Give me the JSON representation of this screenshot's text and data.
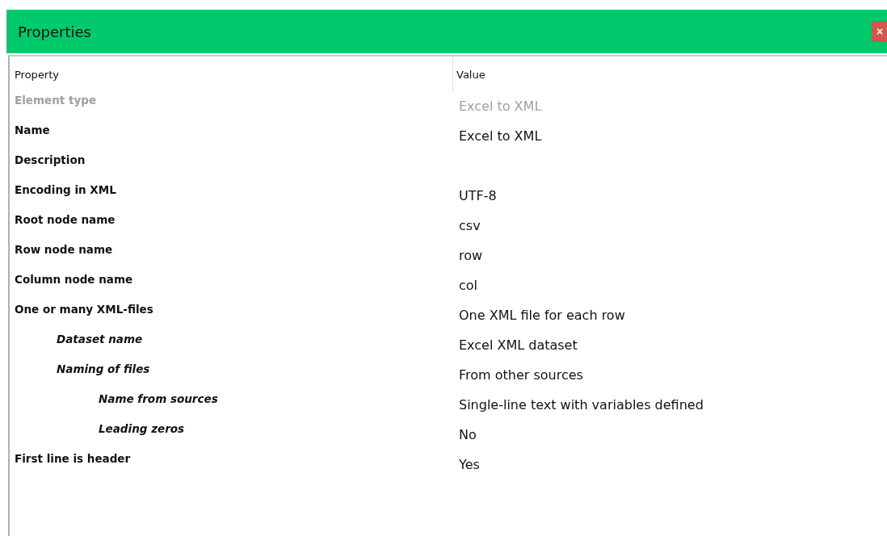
{
  "window": {
    "title": "Properties",
    "close": "×"
  },
  "table": {
    "columns": [
      "Property",
      "Value"
    ],
    "rows": [
      {
        "property": "Element type",
        "value": "Excel to XML",
        "disabled": true
      },
      {
        "property": "Name",
        "value": "Excel to XML",
        "disabled": false
      },
      {
        "property": "Description",
        "disabled": false
      },
      {
        "property": "Encoding in XML",
        "value": "UTF-8",
        "disabled": false
      },
      {
        "property": "Root node name",
        "value": "csv",
        "disabled": false
      },
      {
        "property": "Row node name",
        "value": "row",
        "disabled": false
      },
      {
        "property": "Column node name",
        "value": "col",
        "disabled": false
      },
      {
        "property": "One or many XML-files",
        "value": "One XML file for each row",
        "disabled": false,
        "children": [
          {
            "property": "Dataset name",
            "value": "Excel XML dataset",
            "disabled": false
          },
          {
            "property": "Naming of files",
            "value": "From other sources",
            "disabled": false,
            "children": [
              {
                "property": "Name from sources",
                "value": "Single-line text with variables defined",
                "disabled": false
              },
              {
                "property": "Leading zeros",
                "value": "No",
                "disabled": false
              }
            ]
          }
        ]
      },
      {
        "property": "First line is header",
        "value": "Yes",
        "disabled": false
      }
    ]
  }
}
